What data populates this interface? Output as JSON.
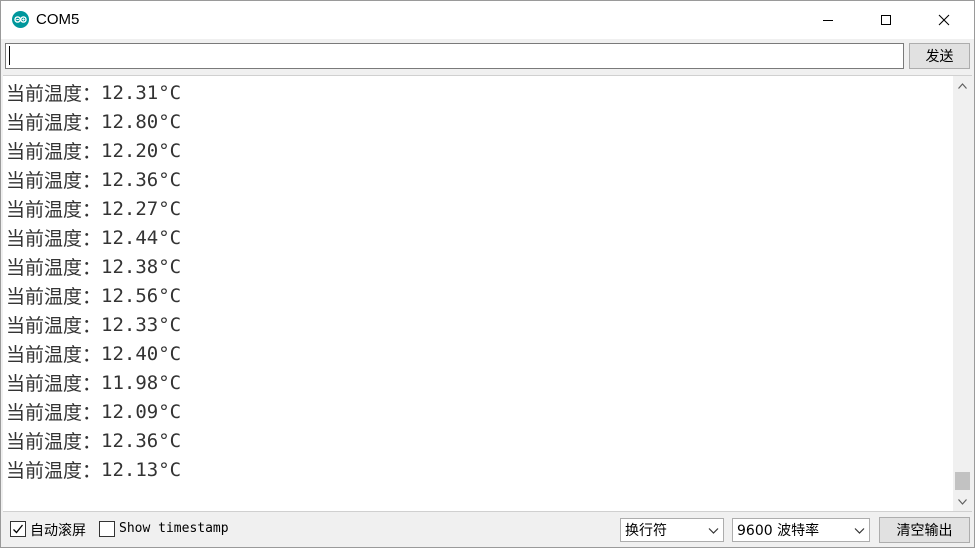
{
  "window": {
    "title": "COM5",
    "icon": "arduino-icon"
  },
  "send": {
    "input_value": "",
    "button_label": "发送"
  },
  "output": {
    "lines": [
      {
        "label": "当前温度：",
        "value": "12.31°C"
      },
      {
        "label": "当前温度：",
        "value": "12.80°C"
      },
      {
        "label": "当前温度：",
        "value": "12.20°C"
      },
      {
        "label": "当前温度：",
        "value": "12.36°C"
      },
      {
        "label": "当前温度：",
        "value": "12.27°C"
      },
      {
        "label": "当前温度：",
        "value": "12.44°C"
      },
      {
        "label": "当前温度：",
        "value": "12.38°C"
      },
      {
        "label": "当前温度：",
        "value": "12.56°C"
      },
      {
        "label": "当前温度：",
        "value": "12.33°C"
      },
      {
        "label": "当前温度：",
        "value": "12.40°C"
      },
      {
        "label": "当前温度：",
        "value": "11.98°C"
      },
      {
        "label": "当前温度：",
        "value": "12.09°C"
      },
      {
        "label": "当前温度：",
        "value": "12.36°C"
      },
      {
        "label": "当前温度：",
        "value": "12.13°C"
      }
    ]
  },
  "bottom": {
    "autoscroll_label": "自动滚屏",
    "autoscroll_checked": true,
    "timestamp_label": "Show timestamp",
    "timestamp_checked": false,
    "line_ending_selected": "换行符",
    "baud_selected": "9600 波特率",
    "clear_label": "清空输出"
  },
  "colors": {
    "arduino_teal": "#00979c",
    "text": "#333333"
  }
}
